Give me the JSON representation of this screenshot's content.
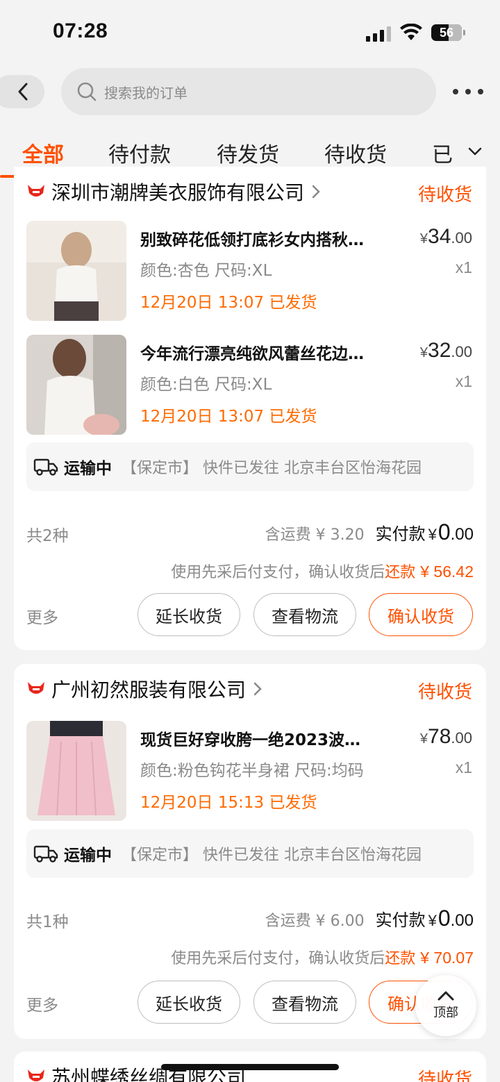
{
  "status_bar": {
    "time": "07:28",
    "battery": "56",
    "battery_level": 0.56
  },
  "header": {
    "search_placeholder": "搜索我的订单",
    "icons": {
      "back": "back-arrow-icon",
      "search": "search-icon",
      "more": "more-dots-icon"
    }
  },
  "tabs": [
    {
      "label": "全部",
      "active": true
    },
    {
      "label": "待付款",
      "active": false
    },
    {
      "label": "待发货",
      "active": false
    },
    {
      "label": "待收货",
      "active": false
    },
    {
      "label": "已",
      "active": false
    }
  ],
  "orders": [
    {
      "shop": "深圳市潮牌美衣服饰有限公司",
      "status": "待收货",
      "items": [
        {
          "title": "别致碎花低领打底衫女内搭秋…",
          "sku": "颜色:杏色 尺码:XL",
          "ship_time": "12月20日 13:07 已发货",
          "price_cur": "¥",
          "price_int": "34",
          "price_dec": ".00",
          "qty": "x1"
        },
        {
          "title": "今年流行漂亮纯欲风蕾丝花边…",
          "sku": "颜色:白色 尺码:XL",
          "ship_time": "12月20日 13:07 已发货",
          "price_cur": "¥",
          "price_int": "32",
          "price_dec": ".00",
          "qty": "x1"
        }
      ],
      "logistics": {
        "status": "运输中",
        "detail": "【保定市】 快件已发往 北京丰台区怡海花园"
      },
      "summary": {
        "count": "共2种",
        "ship_fee": "含运费 ¥ 3.20",
        "paid_label": "实付款",
        "paid_cur": "¥",
        "paid_int": "0",
        "paid_dec": ".00"
      },
      "repay": {
        "prefix": "使用先采后付支付，确认收货后",
        "label": "还款",
        "amount": "¥ 56.42"
      },
      "actions": {
        "more": "更多",
        "extend": "延长收货",
        "logistics": "查看物流",
        "confirm": "确认收货"
      }
    },
    {
      "shop": "广州初然服装有限公司",
      "status": "待收货",
      "items": [
        {
          "title": "现货巨好穿收胯一绝2023波…",
          "sku": "颜色:粉色钩花半身裙 尺码:均码",
          "ship_time": "12月20日 15:13 已发货",
          "price_cur": "¥",
          "price_int": "78",
          "price_dec": ".00",
          "qty": "x1"
        }
      ],
      "logistics": {
        "status": "运输中",
        "detail": "【保定市】 快件已发往 北京丰台区怡海花园"
      },
      "summary": {
        "count": "共1种",
        "ship_fee": "含运费 ¥ 6.00",
        "paid_label": "实付款",
        "paid_cur": "¥",
        "paid_int": "0",
        "paid_dec": ".00"
      },
      "repay": {
        "prefix": "使用先采后付支付，确认收货后",
        "label": "还款",
        "amount": "¥ 70.07"
      },
      "actions": {
        "more": "更多",
        "extend": "延长收货",
        "logistics": "查看物流",
        "confirm": "确认收货"
      }
    },
    {
      "shop": "苏州蝶绣丝绸有限公司",
      "status": "待收货"
    }
  ],
  "back_to_top": "顶部",
  "colors": {
    "accent": "#ff5000",
    "ship_orange": "#ff6a00",
    "muted": "#8a8a8a",
    "background": "#f3f3f3"
  }
}
